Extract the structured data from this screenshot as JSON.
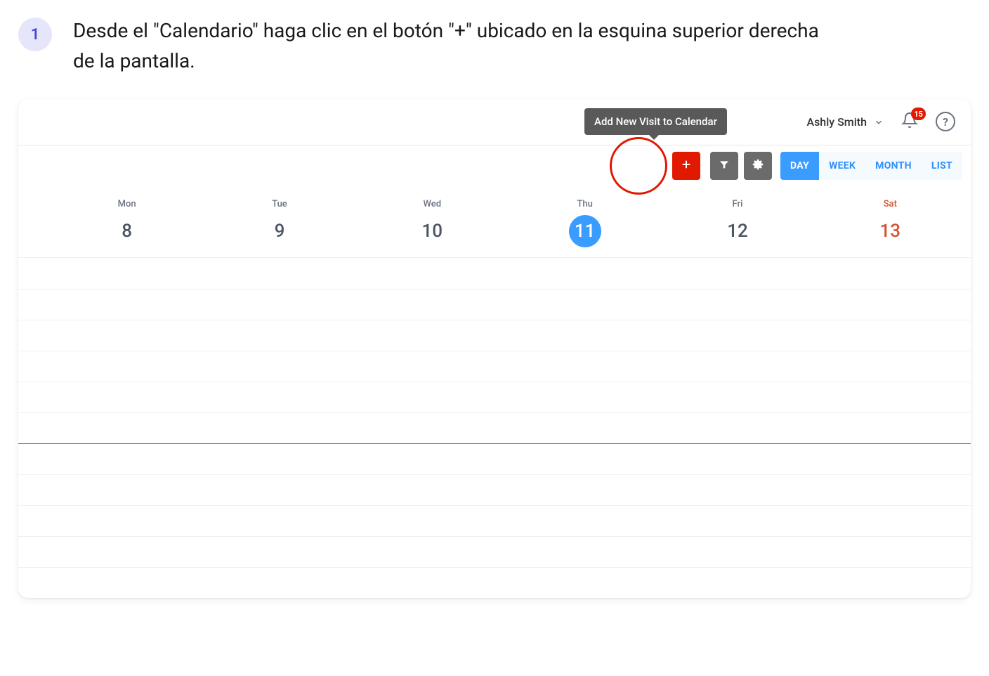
{
  "step": {
    "number": "1",
    "text": "Desde el \"Calendario\" haga clic en el botón \"+\" ubicado en la esquina superior derecha de la pantalla."
  },
  "header": {
    "tooltip": "Add New Visit to Calendar",
    "user_name": "Ashly Smith",
    "notification_count": "15"
  },
  "toolbar": {
    "views": {
      "day": "DAY",
      "week": "WEEK",
      "month": "MONTH",
      "list": "LIST"
    }
  },
  "calendar": {
    "days": [
      {
        "dow": "Mon",
        "num": "8",
        "today": false,
        "weekend": false
      },
      {
        "dow": "Tue",
        "num": "9",
        "today": false,
        "weekend": false
      },
      {
        "dow": "Wed",
        "num": "10",
        "today": false,
        "weekend": false
      },
      {
        "dow": "Thu",
        "num": "11",
        "today": true,
        "weekend": false
      },
      {
        "dow": "Fri",
        "num": "12",
        "today": false,
        "weekend": false
      },
      {
        "dow": "Sat",
        "num": "13",
        "today": false,
        "weekend": true
      }
    ]
  }
}
